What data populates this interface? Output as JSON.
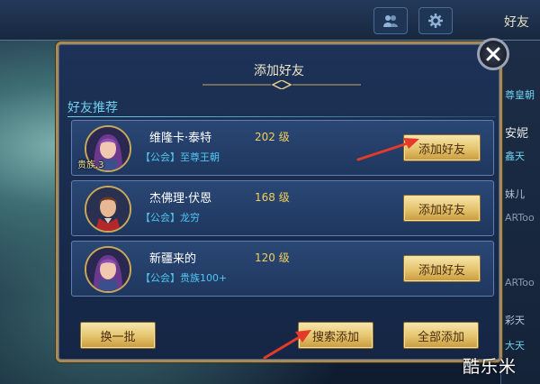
{
  "top": {
    "friends_tab": "好友"
  },
  "dialog": {
    "title": "添加好友",
    "section": "好友推荐",
    "players": [
      {
        "name": "维隆卡·泰特",
        "level": "202 级",
        "guild_prefix": "【公会】",
        "guild": "至尊王朝",
        "noble": "贵族.3",
        "button": "添加好友"
      },
      {
        "name": "杰佛理·伏恩",
        "level": "168 级",
        "guild_prefix": "【公会】",
        "guild": "龙穷",
        "noble": "",
        "button": "添加好友"
      },
      {
        "name": "新疆来的",
        "level": "120 级",
        "guild_prefix": "【公会】",
        "guild": "贵族100+",
        "noble": "",
        "button": "添加好友"
      }
    ],
    "buttons": {
      "refresh": "换一批",
      "search_add": "搜索添加",
      "add_all": "全部添加"
    }
  },
  "side_list": [
    "尊皇朝",
    "安妮",
    "鑫天",
    "妹儿",
    "ARToo",
    "ARToo",
    "彩天",
    "大天"
  ],
  "watermark": "酷乐米",
  "colors": {
    "gold_border": "#a88b52",
    "guild_blue": "#4fc7f1",
    "level_gold": "#f2cf5a",
    "arrow_red": "#e33a2c"
  },
  "icons": {
    "close": "close-icon",
    "top_tab_1": "friends-icon",
    "top_tab_2": "gear-icon"
  }
}
